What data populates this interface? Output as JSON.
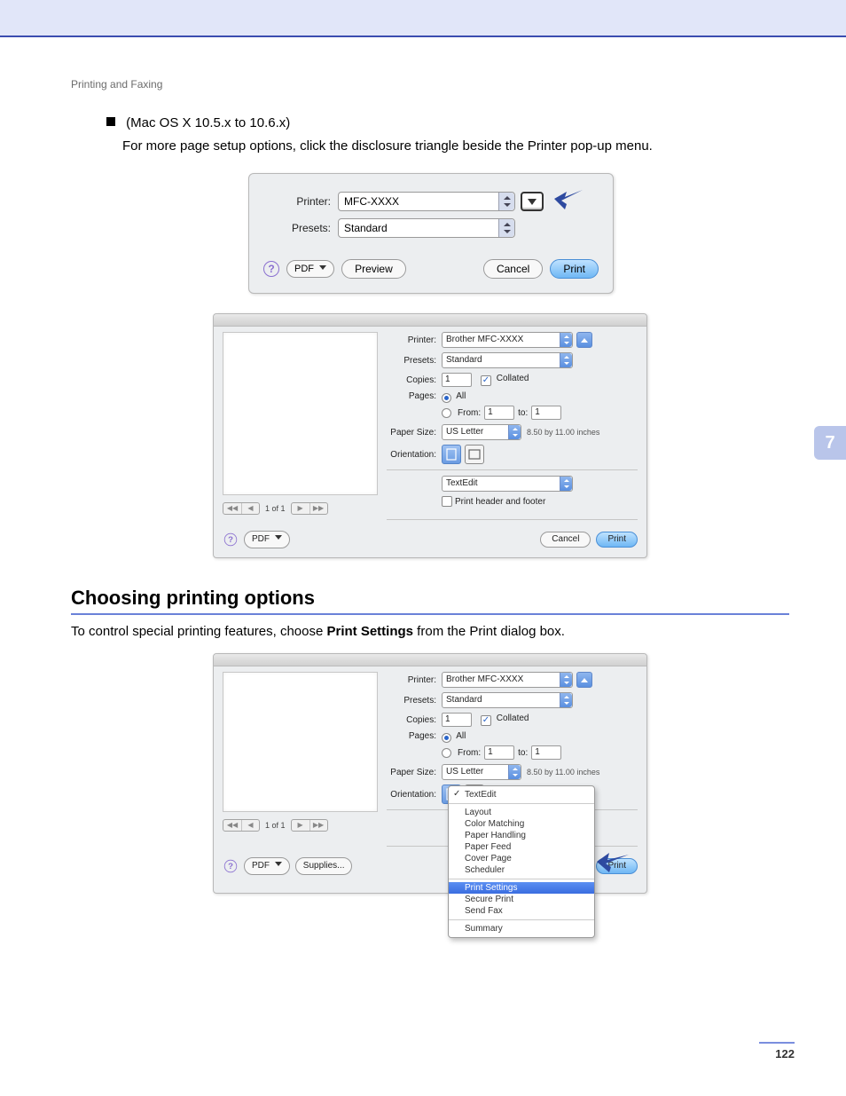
{
  "running_head": "Printing and Faxing",
  "side_tab": "7",
  "page_number": "122",
  "bullet": "(Mac OS X 10.5.x to 10.6.x)",
  "body": "For more page setup options, click the disclosure triangle beside the Printer pop-up menu.",
  "heading": "Choosing printing options",
  "body2_a": "To control special printing features, choose ",
  "body2_b": "Print Settings",
  "body2_c": " from the Print dialog box.",
  "compact": {
    "printer_label": "Printer:",
    "printer_value": "MFC-XXXX",
    "presets_label": "Presets:",
    "presets_value": "Standard",
    "help": "?",
    "pdf": "PDF",
    "preview": "Preview",
    "cancel": "Cancel",
    "print": "Print"
  },
  "exp": {
    "printer_label": "Printer:",
    "printer_value": "Brother MFC-XXXX",
    "presets_label": "Presets:",
    "presets_value": "Standard",
    "copies_label": "Copies:",
    "copies_value": "1",
    "collated": "Collated",
    "pages_label": "Pages:",
    "all": "All",
    "from": "From:",
    "from_value": "1",
    "to": "to:",
    "to_value": "1",
    "papersize_label": "Paper Size:",
    "papersize_value": "US Letter",
    "papersize_dim": "8.50 by 11.00 inches",
    "orientation_label": "Orientation:",
    "section_value": "TextEdit",
    "print_header_footer": "Print header and footer",
    "nav_count": "1 of 1",
    "help": "?",
    "pdf": "PDF",
    "supplies": "Supplies...",
    "cancel": "Cancel",
    "print": "Print"
  },
  "menu": {
    "items": [
      "TextEdit",
      "Layout",
      "Color Matching",
      "Paper Handling",
      "Paper Feed",
      "Cover Page",
      "Scheduler",
      "Print Settings",
      "Secure Print",
      "Send Fax",
      "Summary"
    ]
  }
}
